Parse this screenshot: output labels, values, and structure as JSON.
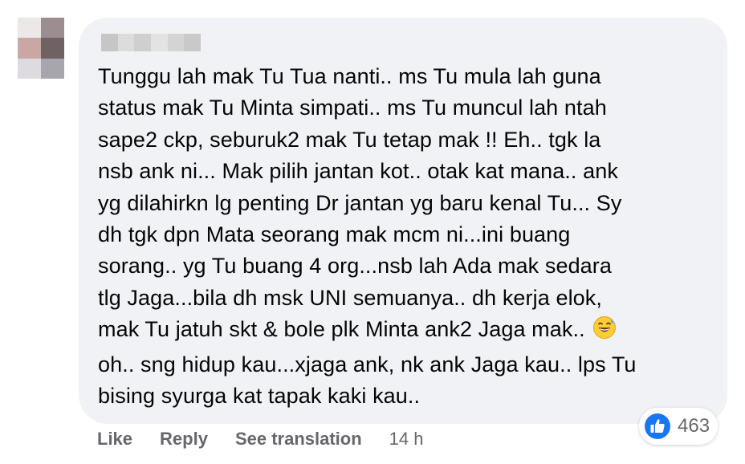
{
  "comment": {
    "author": {
      "avatar_icon": "blurred-avatar",
      "name_blurred": true
    },
    "lines": [
      "Tunggu lah mak Tu Tua nanti.. ms Tu mula lah guna",
      "status mak Tu Minta simpati.. ms Tu muncul lah ntah",
      "sape2 ckp, seburuk2 mak Tu tetap mak !! Eh.. tgk la",
      "nsb ank ni... Mak pilih jantan kot.. otak kat mana.. ank",
      "yg dilahirkn lg penting Dr jantan yg baru kenal Tu... Sy",
      "dh tgk dpn Mata seorang mak mcm ni...ini buang",
      "sorang.. yg Tu buang 4 org...nsb lah Ada mak sedara",
      "tlg Jaga...bila dh msk UNI semuanya.. dh kerja elok,",
      "mak Tu jatuh skt & bole plk Minta ank2 Jaga mak..",
      "oh.. sng hidup kau...xjaga ank, nk ank Jaga kau.. lps Tu",
      "bising syurga kat tapak kaki kau.."
    ],
    "emoji_icon": "grinning-sweat-emoji",
    "reactions": {
      "icon": "like-icon",
      "count": "463",
      "color": "#1877f2"
    },
    "actions": {
      "like_label": "Like",
      "reply_label": "Reply",
      "translate_label": "See translation",
      "timestamp": "14 h"
    }
  },
  "colors": {
    "bubble": "#f0f2f5",
    "text": "#050505",
    "secondary": "#65676b"
  }
}
